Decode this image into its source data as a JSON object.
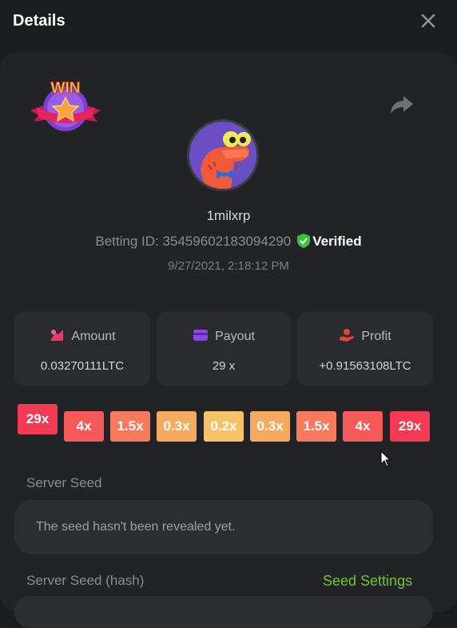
{
  "header": {
    "title": "Details"
  },
  "user": {
    "name": "1milxrp",
    "betting_id_label": "Betting ID:",
    "betting_id": "35459602183094290",
    "verified_label": "Verified",
    "date": "9/27/2021, 2:18:12 PM"
  },
  "badge": {
    "text": "WIN"
  },
  "stats": {
    "amount": {
      "label": "Amount",
      "value": "0.03270111LTC"
    },
    "payout": {
      "label": "Payout",
      "value": "29 x"
    },
    "profit": {
      "label": "Profit",
      "value": "+0.91563108LTC"
    }
  },
  "multipliers": {
    "selected": "29x",
    "items": [
      "4x",
      "1.5x",
      "0.3x",
      "0.2x",
      "0.3x",
      "1.5x",
      "4x",
      "29x"
    ]
  },
  "seeds": {
    "server_seed_label": "Server Seed",
    "server_seed_value": "The seed hasn't been revealed yet.",
    "server_seed_hash_label": "Server Seed (hash)",
    "seed_settings_label": "Seed Settings"
  },
  "colors": {
    "accent_green": "#72c13a",
    "multiplier_high": "#f23a55",
    "multiplier_mid": "#f57a5e",
    "multiplier_low": "#f6a960",
    "multiplier_min": "#f8c266"
  }
}
